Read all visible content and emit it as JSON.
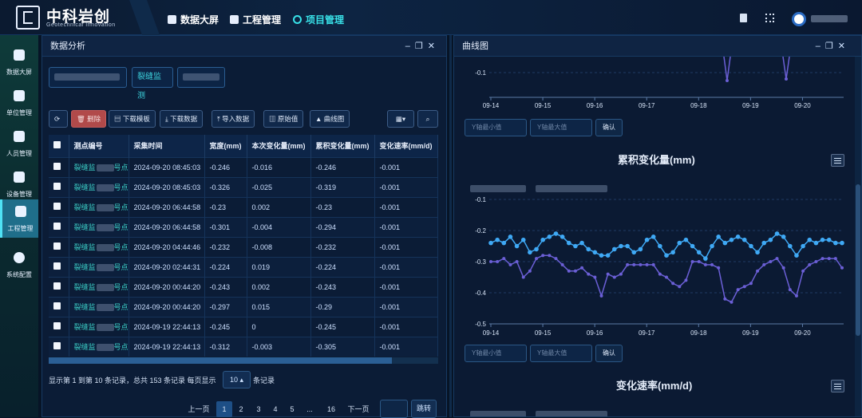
{
  "brand": {
    "name": "中科岩创",
    "subtitle": "Geotechnical Innovation"
  },
  "nav": [
    {
      "label": "数据大屏",
      "x": 210,
      "active": false
    },
    {
      "label": "工程管理",
      "x": 288,
      "active": false
    },
    {
      "label": "项目管理",
      "x": 367,
      "active": true
    }
  ],
  "sidebar": [
    {
      "label": "数据大屏"
    },
    {
      "label": "单位管理"
    },
    {
      "label": "人员管理"
    },
    {
      "label": "设备管理"
    },
    {
      "label": "工程管理",
      "active": true
    },
    {
      "label": "系统配置"
    }
  ],
  "left_panel": {
    "title": "数据分析",
    "filter_tag": "裂缝监测",
    "toolbar": {
      "delete": "删除",
      "download_template": "下载模板",
      "download_data": "下载数据",
      "import": "导入数据",
      "raw": "原始值",
      "curve": "曲线图"
    },
    "columns": [
      "测点编号",
      "采集时间",
      "宽度(mm)",
      "本次变化量(mm)",
      "累积变化量(mm)",
      "变化速率(mm/d)"
    ],
    "rows": [
      [
        "裂缝监",
        "2024-09-20 08:45:03",
        "-0.246",
        "-0.016",
        "-0.246",
        "-0.001"
      ],
      [
        "裂缝监",
        "2024-09-20 08:45:03",
        "-0.326",
        "-0.025",
        "-0.319",
        "-0.001"
      ],
      [
        "裂缝监",
        "2024-09-20 06:44:58",
        "-0.23",
        "0.002",
        "-0.23",
        "-0.001"
      ],
      [
        "裂缝监",
        "2024-09-20 06:44:58",
        "-0.301",
        "-0.004",
        "-0.294",
        "-0.001"
      ],
      [
        "裂缝监",
        "2024-09-20 04:44:46",
        "-0.232",
        "-0.008",
        "-0.232",
        "-0.001"
      ],
      [
        "裂缝监",
        "2024-09-20 02:44:31",
        "-0.224",
        "0.019",
        "-0.224",
        "-0.001"
      ],
      [
        "裂缝监",
        "2024-09-20 00:44:20",
        "-0.243",
        "0.002",
        "-0.243",
        "-0.001"
      ],
      [
        "裂缝监",
        "2024-09-20 00:44:20",
        "-0.297",
        "0.015",
        "-0.29",
        "-0.001"
      ],
      [
        "裂缝监",
        "2024-09-19 22:44:13",
        "-0.245",
        "0",
        "-0.245",
        "-0.001"
      ],
      [
        "裂缝监",
        "2024-09-19 22:44:13",
        "-0.312",
        "-0.003",
        "-0.305",
        "-0.001"
      ]
    ],
    "pager": {
      "info": "显示第 1 到第 10 条记录，总共 153 条记录 每页显示",
      "page_size": "10",
      "suffix": "条记录",
      "prev": "上一页",
      "pages": [
        "1",
        "2",
        "3",
        "4",
        "5",
        "...",
        "16"
      ],
      "next": "下一页",
      "jump": "跳转"
    }
  },
  "right_panel": {
    "title": "曲线图",
    "y_min_placeholder": "Y轴最小值",
    "y_max_placeholder": "Y轴最大值",
    "confirm": "确认",
    "chart2_title": "累积变化量(mm)",
    "chart3_title": "变化速率(mm/d)"
  },
  "chart_data": {
    "type": "line",
    "title": "累积变化量(mm)",
    "x_ticks": [
      "09-14",
      "09-15",
      "09-16",
      "09-17",
      "09-18",
      "09-19",
      "09-20"
    ],
    "y_ticks": [
      "-0.1",
      "-0.2",
      "-0.3",
      "-0.4",
      "-0.5"
    ],
    "ylim": [
      -0.5,
      -0.1
    ],
    "series": [
      {
        "color": "#3fa9f5",
        "values": [
          -0.24,
          -0.23,
          -0.24,
          -0.22,
          -0.25,
          -0.23,
          -0.27,
          -0.26,
          -0.23,
          -0.22,
          -0.21,
          -0.22,
          -0.24,
          -0.25,
          -0.24,
          -0.26,
          -0.27,
          -0.28,
          -0.28,
          -0.26,
          -0.25,
          -0.25,
          -0.27,
          -0.26,
          -0.23,
          -0.22,
          -0.25,
          -0.28,
          -0.27,
          -0.24,
          -0.23,
          -0.25,
          -0.27,
          -0.29,
          -0.25,
          -0.22,
          -0.24,
          -0.23,
          -0.22,
          -0.23,
          -0.25,
          -0.27,
          -0.24,
          -0.23,
          -0.21,
          -0.22,
          -0.25,
          -0.28,
          -0.25,
          -0.23,
          -0.24,
          -0.23,
          -0.23,
          -0.24,
          -0.24
        ]
      },
      {
        "color": "#6b5fd6",
        "values": [
          -0.3,
          -0.3,
          -0.29,
          -0.31,
          -0.3,
          -0.35,
          -0.33,
          -0.29,
          -0.28,
          -0.28,
          -0.29,
          -0.31,
          -0.33,
          -0.33,
          -0.32,
          -0.34,
          -0.35,
          -0.41,
          -0.34,
          -0.35,
          -0.34,
          -0.31,
          -0.31,
          -0.31,
          -0.31,
          -0.31,
          -0.34,
          -0.35,
          -0.37,
          -0.38,
          -0.36,
          -0.3,
          -0.3,
          -0.31,
          -0.31,
          -0.32,
          -0.42,
          -0.43,
          -0.39,
          -0.38,
          -0.37,
          -0.33,
          -0.31,
          -0.3,
          -0.29,
          -0.32,
          -0.39,
          -0.41,
          -0.33,
          -0.31,
          -0.3,
          -0.29,
          -0.29,
          -0.29,
          -0.32
        ]
      }
    ],
    "top_chart": {
      "x_ticks": [
        "09-14",
        "09-15",
        "09-16",
        "09-17",
        "09-18",
        "09-19",
        "09-20"
      ],
      "y_ticks": [
        "-0.1"
      ]
    }
  }
}
